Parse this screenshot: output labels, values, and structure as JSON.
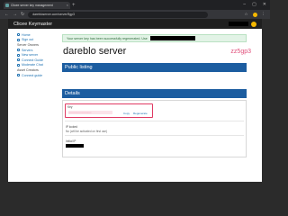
{
  "browser": {
    "tab_title": "Clicee server key management",
    "url": "darebloserver.com/server/5gp3",
    "new_tab_label": "+",
    "window_controls": [
      "–",
      "▢",
      "✕"
    ]
  },
  "site": {
    "brand": "Clicee Keymaster"
  },
  "sidebar": {
    "items": [
      {
        "label": "Home",
        "icon": "home-icon",
        "link": true
      },
      {
        "label": "Sign out",
        "icon": "signout-icon",
        "link": true
      },
      {
        "label": "Server Owners",
        "icon": "",
        "link": false
      },
      {
        "label": "Servers",
        "icon": "servers-icon",
        "link": true
      },
      {
        "label": "New server",
        "icon": "plus-icon",
        "link": true
      },
      {
        "label": "Connect Guide",
        "icon": "guide-icon",
        "link": true
      },
      {
        "label": "Moderate Chat",
        "icon": "chat-icon",
        "link": true
      },
      {
        "label": "Asset Creators",
        "icon": "",
        "link": false
      },
      {
        "label": "Connect guide",
        "icon": "guide-icon",
        "link": true
      }
    ]
  },
  "alert": {
    "text": "Your server key has been successfully regenerated. Use"
  },
  "server": {
    "title": "dareblo server",
    "id": "zz5gp3"
  },
  "public_listing": {
    "label": "Public listing"
  },
  "details": {
    "label": "Details",
    "key_label": "Key",
    "key_value": "••••••••••••••••••••••••••",
    "copy_label": "Copy",
    "regenerate_label": "Regenerate",
    "ip_locked_label": "IP locked",
    "ip_locked_value": "No (will be activated on first use)",
    "initial_ip_label": "Initial IP"
  },
  "colors": {
    "header_bg": "#1f1f1f",
    "panel_blue": "#1c5da0",
    "alert_green_bg": "#e2f3e6",
    "key_highlight": "#e03a63",
    "server_id_pink": "#e04f7b",
    "avatar_yellow": "#f5b800"
  }
}
